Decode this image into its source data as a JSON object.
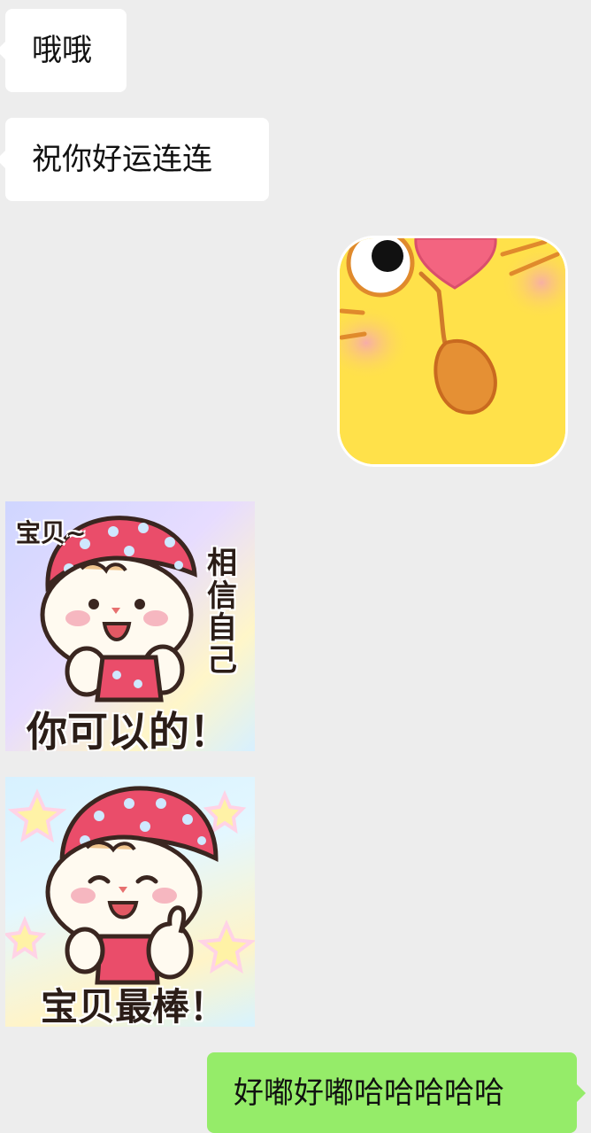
{
  "messages": [
    {
      "side": "left",
      "type": "text",
      "text": "哦哦"
    },
    {
      "side": "left",
      "type": "text",
      "text": "祝你好运连连"
    },
    {
      "side": "right",
      "type": "sticker",
      "sticker": "yellow-cat-face"
    },
    {
      "side": "left",
      "type": "sticker",
      "sticker": "baby-you-can-do-it",
      "caption_top": "宝贝~",
      "caption_side": "相信自己",
      "caption_main": "你可以的！"
    },
    {
      "side": "left",
      "type": "sticker",
      "sticker": "baby-thumbs-up",
      "caption_main": "宝贝最棒！"
    },
    {
      "side": "right",
      "type": "text",
      "text": "好嘟好嘟哈哈哈哈哈"
    }
  ],
  "colors": {
    "background": "#ededed",
    "bubble_left": "#ffffff",
    "bubble_right": "#95ec69"
  }
}
